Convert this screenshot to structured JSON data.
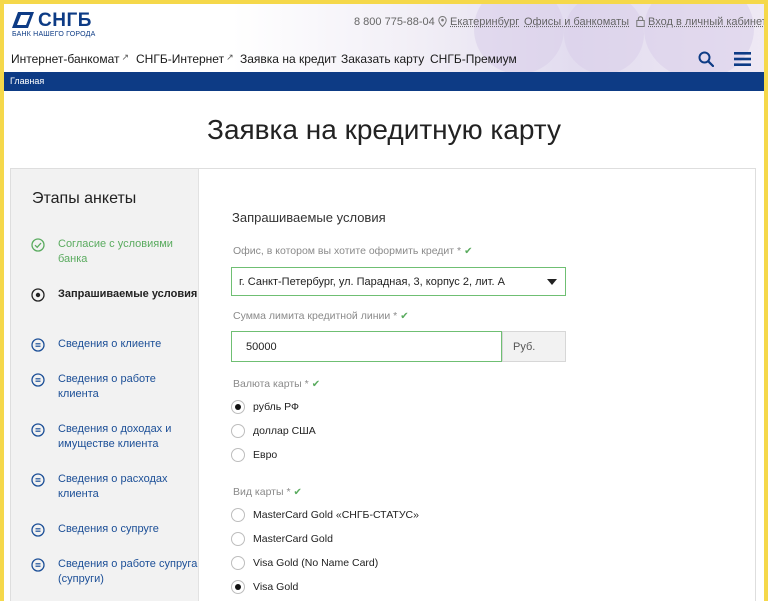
{
  "header": {
    "logo_text": "СНГБ",
    "logo_subtitle": "БАНК НАШЕГО ГОРОДА",
    "phone": "8 800 775-88-04",
    "city": "Екатеринбург",
    "offices_link": "Офисы и банкоматы",
    "cabinet_link": "Вход в личный кабинет",
    "nav": [
      {
        "label": "Интернет-банкомат"
      },
      {
        "label": "СНГБ-Интернет"
      },
      {
        "label": "Заявка на кредит"
      },
      {
        "label": "Заказать карту"
      },
      {
        "label": "СНГБ-Премиум"
      }
    ]
  },
  "breadcrumb": "Главная",
  "page_title": "Заявка на кредитную карту",
  "steps": {
    "title": "Этапы анкеты",
    "items": [
      {
        "label": "Согласие с условиями банка",
        "state": "done"
      },
      {
        "label": "Запрашиваемые условия",
        "state": "active"
      },
      {
        "label": "Сведения о клиенте",
        "state": "pending"
      },
      {
        "label": "Сведения о работе клиента",
        "state": "pending"
      },
      {
        "label": "Сведения о доходах и имуществе клиента",
        "state": "pending"
      },
      {
        "label": "Сведения о расходах клиента",
        "state": "pending"
      },
      {
        "label": "Сведения о супруге",
        "state": "pending"
      },
      {
        "label": "Сведения о работе супруга (супруги)",
        "state": "pending"
      }
    ]
  },
  "form": {
    "section_title": "Запрашиваемые условия",
    "office": {
      "label": "Офис, в котором вы хотите оформить кредит *",
      "value": "г. Санкт-Петербург, ул. Парадная, 3, корпус 2, лит. А"
    },
    "limit": {
      "label": "Сумма лимита кредитной линии *",
      "value": "50000",
      "unit": "Руб."
    },
    "currency": {
      "label": "Валюта карты *",
      "options": [
        {
          "label": "рубль РФ",
          "checked": true
        },
        {
          "label": "доллар США",
          "checked": false
        },
        {
          "label": "Евро",
          "checked": false
        }
      ]
    },
    "card_type": {
      "label": "Вид карты *",
      "options": [
        {
          "label": "MasterCard Gold «СНГБ-СТАТУС»",
          "checked": false
        },
        {
          "label": "MasterCard Gold",
          "checked": false
        },
        {
          "label": "Visa Gold (No Name Card)",
          "checked": false
        },
        {
          "label": "Visa Gold",
          "checked": true
        }
      ]
    }
  },
  "colors": {
    "brand_blue": "#0d3b85",
    "accent_green": "#5aab5f",
    "frame_yellow": "#f5d84a"
  }
}
